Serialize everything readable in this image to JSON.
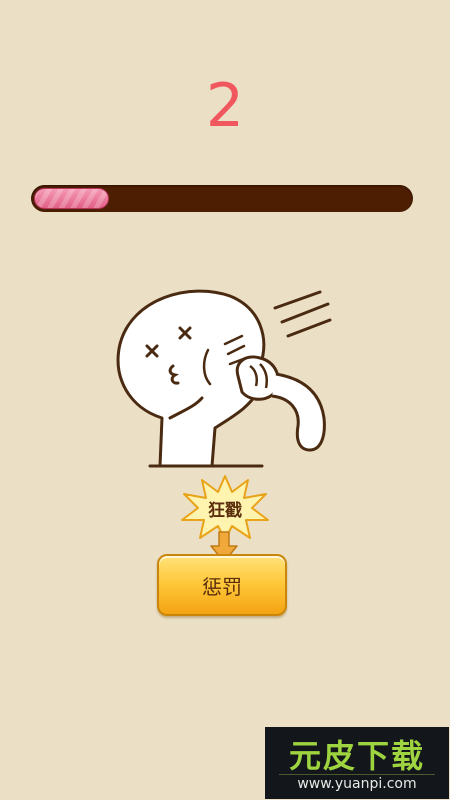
{
  "game": {
    "score": "2",
    "progress": 0.2,
    "action_label": "狂戳",
    "punish_label": "惩罚"
  },
  "watermark": {
    "title": "元皮下载",
    "url": "www.yuanpi.com"
  },
  "colors": {
    "background": "#ebe0c6",
    "score": "#f0575f",
    "track": "#4d1e02",
    "fill": "#e8739a",
    "button": "#ffc93c"
  }
}
